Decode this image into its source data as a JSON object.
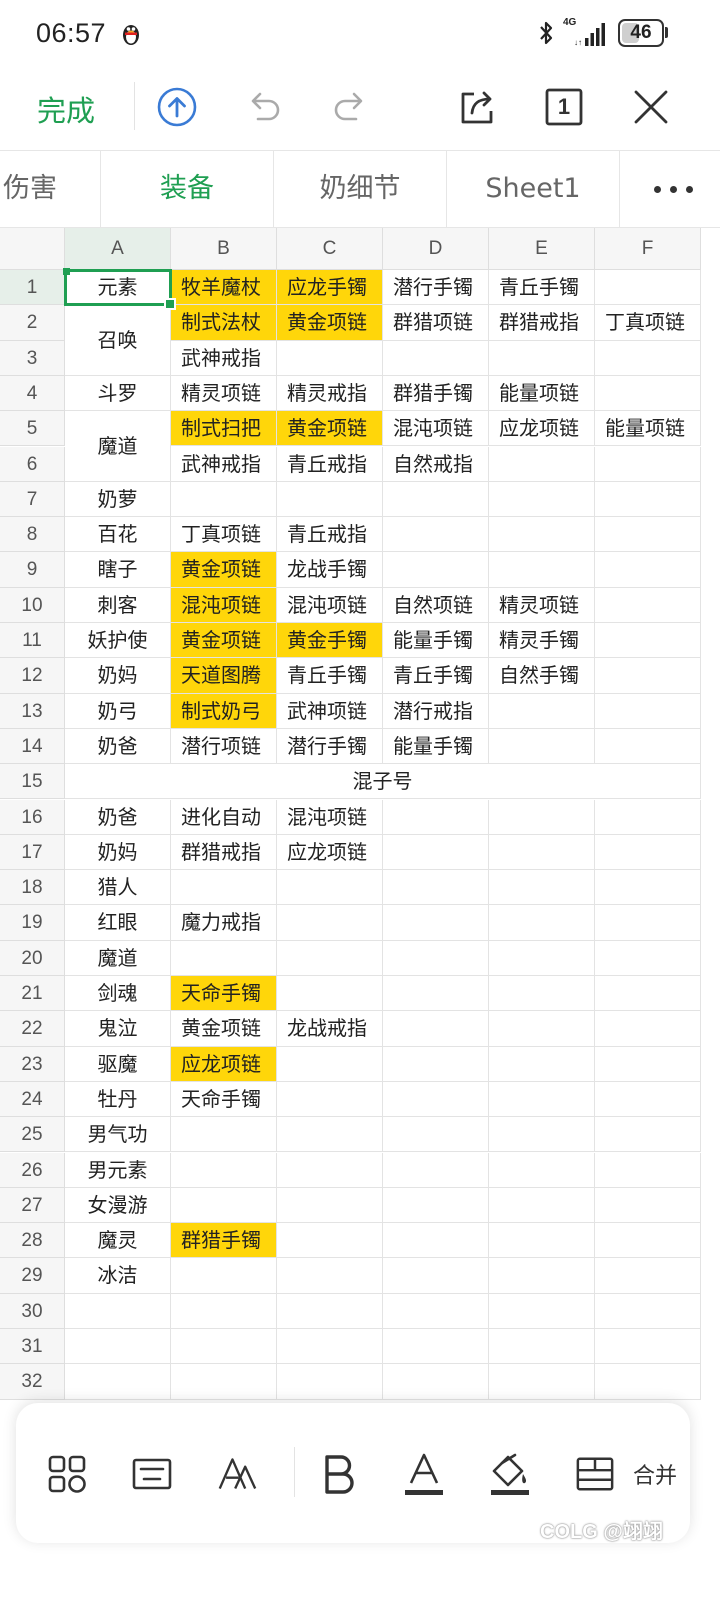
{
  "status_bar": {
    "time": "06:57",
    "network_label": "4G",
    "battery": "46",
    "battery_level": 0.46
  },
  "toolbar": {
    "done_label": "完成",
    "icons": [
      "upload-icon",
      "undo-icon",
      "redo-icon",
      "share-icon",
      "sheet-count-icon",
      "close-icon"
    ],
    "sheet_count": "1",
    "accent_color": "#1f9f52"
  },
  "tabs": [
    {
      "label": "伤害",
      "active": false
    },
    {
      "label": "装备",
      "active": true
    },
    {
      "label": "奶细节",
      "active": false
    },
    {
      "label": "Sheet1",
      "active": false
    }
  ],
  "columns": [
    "A",
    "B",
    "C",
    "D",
    "E",
    "F"
  ],
  "rows": [
    "1",
    "2",
    "3",
    "4",
    "5",
    "6",
    "7",
    "8",
    "9",
    "10",
    "11",
    "12",
    "13",
    "14",
    "15",
    "16",
    "17",
    "18",
    "19",
    "20",
    "21",
    "22",
    "23",
    "24",
    "25",
    "26",
    "27",
    "28",
    "29",
    "30",
    "31",
    "32"
  ],
  "highlight_color": "#ffd60a",
  "cells": {
    "r1": [
      "元素",
      "牧羊魔杖",
      "应龙手镯",
      "潜行手镯",
      "青丘手镯",
      ""
    ],
    "r2": [
      "召唤",
      "制式法杖",
      "黄金项链",
      "群猎项链",
      "群猎戒指",
      "丁真项链"
    ],
    "r3": [
      "",
      "武神戒指",
      "",
      "",
      "",
      ""
    ],
    "r4": [
      "斗罗",
      "精灵项链",
      "精灵戒指",
      "群猎手镯",
      "能量项链",
      ""
    ],
    "r5": [
      "魔道",
      "制式扫把",
      "黄金项链",
      "混沌项链",
      "应龙项链",
      "能量项链"
    ],
    "r6": [
      "",
      "武神戒指",
      "青丘戒指",
      "自然戒指",
      "",
      ""
    ],
    "r7": [
      "奶萝",
      "",
      "",
      "",
      "",
      ""
    ],
    "r8": [
      "百花",
      "丁真项链",
      "青丘戒指",
      "",
      "",
      ""
    ],
    "r9": [
      "瞎子",
      "黄金项链",
      "龙战手镯",
      "",
      "",
      ""
    ],
    "r10": [
      "刺客",
      "混沌项链",
      "混沌项链",
      "自然项链",
      "精灵项链",
      ""
    ],
    "r11": [
      "妖护使",
      "黄金项链",
      "黄金手镯",
      "能量手镯",
      "精灵手镯",
      ""
    ],
    "r12": [
      "奶妈",
      "天道图腾",
      "青丘手镯",
      "青丘手镯",
      "自然手镯",
      ""
    ],
    "r13": [
      "奶弓",
      "制式奶弓",
      "武神项链",
      "潜行戒指",
      "",
      ""
    ],
    "r14": [
      "奶爸",
      "潜行项链",
      "潜行手镯",
      "能量手镯",
      "",
      ""
    ],
    "r15_merged": "混子号",
    "r16": [
      "奶爸",
      "进化自动",
      "混沌项链",
      "",
      "",
      ""
    ],
    "r17": [
      "奶妈",
      "群猎戒指",
      "应龙项链",
      "",
      "",
      ""
    ],
    "r18": [
      "猎人",
      "",
      "",
      "",
      "",
      ""
    ],
    "r19": [
      "红眼",
      "魔力戒指",
      "",
      "",
      "",
      ""
    ],
    "r20": [
      "魔道",
      "",
      "",
      "",
      "",
      ""
    ],
    "r21": [
      "剑魂",
      "天命手镯",
      "",
      "",
      "",
      ""
    ],
    "r22": [
      "鬼泣",
      "黄金项链",
      "龙战戒指",
      "",
      "",
      ""
    ],
    "r23": [
      "驱魔",
      "应龙项链",
      "",
      "",
      "",
      ""
    ],
    "r24": [
      "牡丹",
      "天命手镯",
      "",
      "",
      "",
      ""
    ],
    "r25": [
      "男气功",
      "",
      "",
      "",
      "",
      ""
    ],
    "r26": [
      "男元素",
      "",
      "",
      "",
      "",
      ""
    ],
    "r27": [
      "女漫游",
      "",
      "",
      "",
      "",
      ""
    ],
    "r28": [
      "魔灵",
      "群猎手镯",
      "",
      "",
      "",
      ""
    ],
    "r29": [
      "冰洁",
      "",
      "",
      "",
      "",
      ""
    ],
    "r30": [
      "",
      "",
      "",
      "",
      "",
      ""
    ],
    "r31": [
      "",
      "",
      "",
      "",
      "",
      ""
    ],
    "r32": [
      "",
      "",
      "",
      "",
      "",
      ""
    ]
  },
  "merged_a": {
    "r2_3": "召唤",
    "r5_6": "魔道"
  },
  "highlights": [
    "B1",
    "C1",
    "B2",
    "C2",
    "B5",
    "C5",
    "B9",
    "B10",
    "B11",
    "C11",
    "B12",
    "B13",
    "B21",
    "B23",
    "B28"
  ],
  "bottom_toolbar": {
    "icons": [
      "apps-icon",
      "keyboard-icon",
      "text-style-icon",
      "bold-icon",
      "font-color-icon",
      "fill-color-icon",
      "merge-cells-icon"
    ],
    "merge_label": "合并"
  },
  "watermark": "COLG @翊翊"
}
